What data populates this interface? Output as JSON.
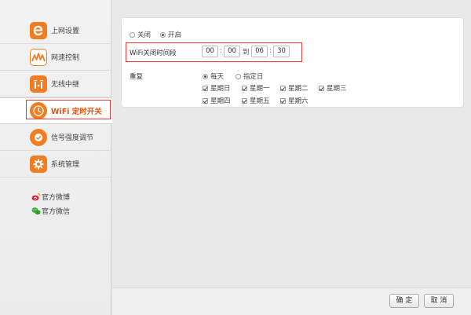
{
  "sidebar": {
    "items": [
      {
        "label": "上网设置",
        "icon": "browser-e-icon",
        "color": "#f07d21"
      },
      {
        "label": "网速控制",
        "icon": "speed-wave-icon",
        "color": "#f07d21"
      },
      {
        "label": "无线中继",
        "icon": "wireless-relay-icon",
        "color": "#f07d21"
      },
      {
        "label": "WiFi 定时开关",
        "icon": "wifi-timer-icon",
        "color": "#f07d21"
      },
      {
        "label": "信号强度调节",
        "icon": "signal-strength-icon",
        "color": "#f07d21"
      },
      {
        "label": "系统管理",
        "icon": "system-gear-icon",
        "color": "#f07d21"
      }
    ],
    "social": [
      {
        "label": "官方微博",
        "icon": "weibo-icon"
      },
      {
        "label": "官方微信",
        "icon": "wechat-icon"
      }
    ]
  },
  "switch": {
    "off_label": "关闭",
    "on_label": "开启",
    "selected": "on"
  },
  "schedule": {
    "label": "WiFi关闭时间段",
    "start_hour": "00",
    "start_minute": "00",
    "to_label": "到",
    "end_hour": "06",
    "end_minute": "30",
    "colon": ":"
  },
  "repeat": {
    "label": "重复",
    "everyday_label": "每天",
    "custom_label": "指定日",
    "selected": "everyday",
    "days": [
      "星期日",
      "星期一",
      "星期二",
      "星期三",
      "星期四",
      "星期五",
      "星期六"
    ]
  },
  "footer": {
    "confirm_label": "确 定",
    "cancel_label": "取 消"
  },
  "colors": {
    "accent": "#f07d21",
    "active_text": "#e2530f",
    "highlight": "#e53935"
  }
}
